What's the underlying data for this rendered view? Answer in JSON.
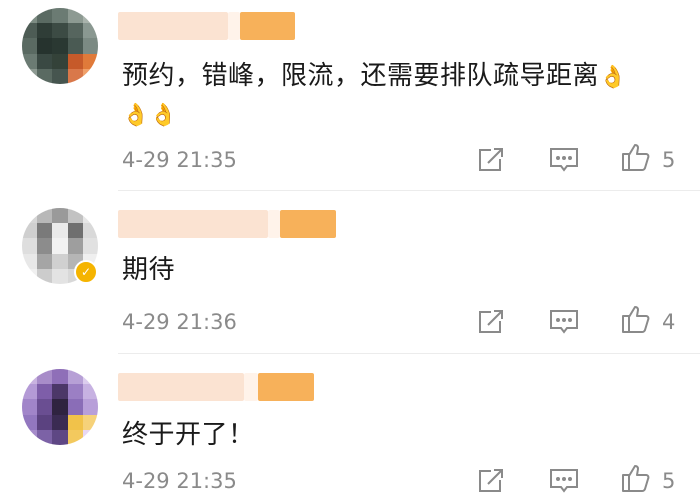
{
  "comments": [
    {
      "text": "预约，错峰，限流，还需要排队疏导距离",
      "emoji_line": "👌👌",
      "timestamp": "4-29 21:35",
      "likes": "5"
    },
    {
      "text": "期待",
      "verified": true,
      "timestamp": "4-29 21:36",
      "likes": "4"
    },
    {
      "text": "终于开了！",
      "timestamp": "4-29 21:35",
      "likes": "5"
    }
  ],
  "icons": {
    "repost": "share-icon",
    "comment": "comment-icon",
    "like": "thumbs-up-icon"
  },
  "colors": {
    "meta_gray": "#8a8a8a",
    "badge": "#f5b400",
    "name_blur": "#fbe3d2",
    "name_accent": "#f7b15a"
  }
}
